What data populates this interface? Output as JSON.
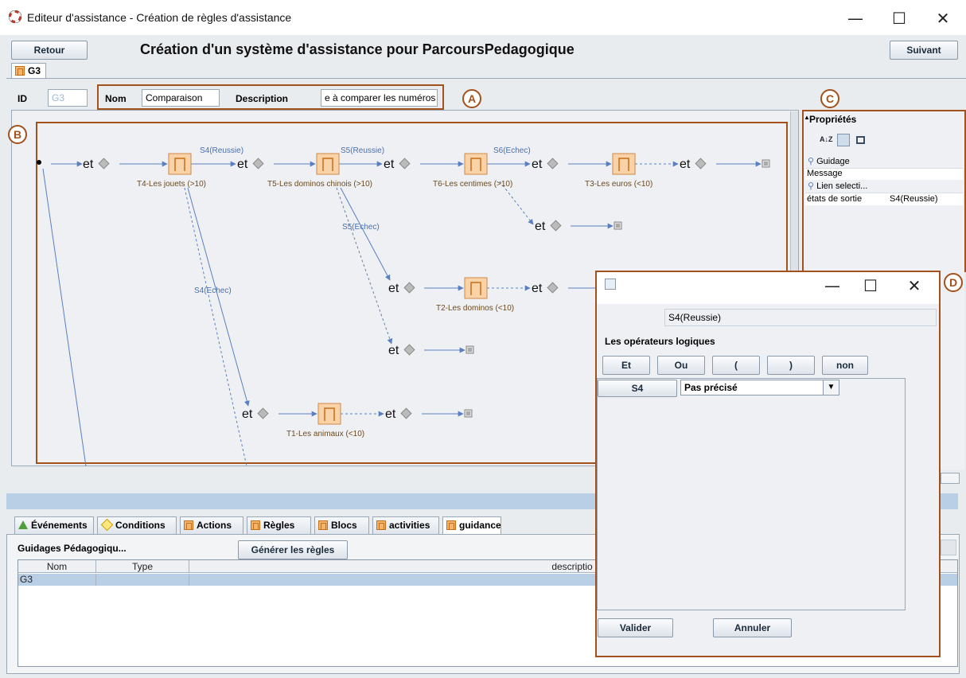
{
  "window": {
    "title": "Editeur d'assistance - Création de règles d'assistance",
    "minimize": "—",
    "maximize": "☐",
    "close": "✕"
  },
  "header": {
    "back_label": "Retour",
    "title": "Création d'un système d'assistance pour ParcoursPedagogique",
    "next_label": "Suivant"
  },
  "doc_tab": {
    "label": "G3"
  },
  "form": {
    "id_label": "ID",
    "id_value": "G3",
    "name_label": "Nom",
    "name_value": "Comparaison",
    "desc_label": "Description",
    "desc_value": "e à comparer les numéros"
  },
  "callouts": {
    "a": "A",
    "b": "B",
    "c": "C",
    "d": "D"
  },
  "graph": {
    "op": "et",
    "blocks": [
      "T4-Les jouets (>10)",
      "T5-Les dominos chinois (>10)",
      "T6-Les centimes (>10)",
      "T3-Les euros (<10)",
      "T2-Les dominos (<10)",
      "T1-Les animaux (<10)"
    ],
    "edges": [
      "S4(Reussie)",
      "S5(Reussie)",
      "S6(Echec)",
      "S5(Echec)",
      "S4(Echec)"
    ]
  },
  "properties": {
    "title": "Propriétés",
    "sort_icon": "A↓Z",
    "section1": "Guidage",
    "row1_key": "Message",
    "row1_value": "",
    "section2": "Lien selecti...",
    "row2_key": "états de sortie",
    "row2_value": "S4(Reussie)"
  },
  "bottom_tabs": [
    {
      "label": "Événements",
      "icon": "triangle-icon"
    },
    {
      "label": "Conditions",
      "icon": "diamond-icon"
    },
    {
      "label": "Actions",
      "icon": "block-icon"
    },
    {
      "label": "Règles",
      "icon": "block-icon"
    },
    {
      "label": "Blocs",
      "icon": "block-icon"
    },
    {
      "label": "activities",
      "icon": "block-icon"
    },
    {
      "label": "guidance",
      "icon": "block-icon"
    }
  ],
  "guidance": {
    "title": "Guidages Pédagogiqu...",
    "generate_label": "Générer les règles",
    "columns": [
      "Nom",
      "Type",
      "descriptio"
    ],
    "rows": [
      [
        "G3",
        "",
        ""
      ]
    ]
  },
  "dialog": {
    "condition": "S4(Reussie)",
    "ops_title": "Les opérateurs logiques",
    "ops": [
      "Et",
      "Ou",
      "(",
      ")",
      "non"
    ],
    "var_label": "S4",
    "select_value": "Pas précisé",
    "validate_label": "Valider",
    "cancel_label": "Annuler"
  },
  "colors": {
    "accent_orange": "#a2511c",
    "block_fill": "#f9d2a8",
    "edge_blue": "#5a7fc0",
    "selection": "#b8cfe5"
  }
}
